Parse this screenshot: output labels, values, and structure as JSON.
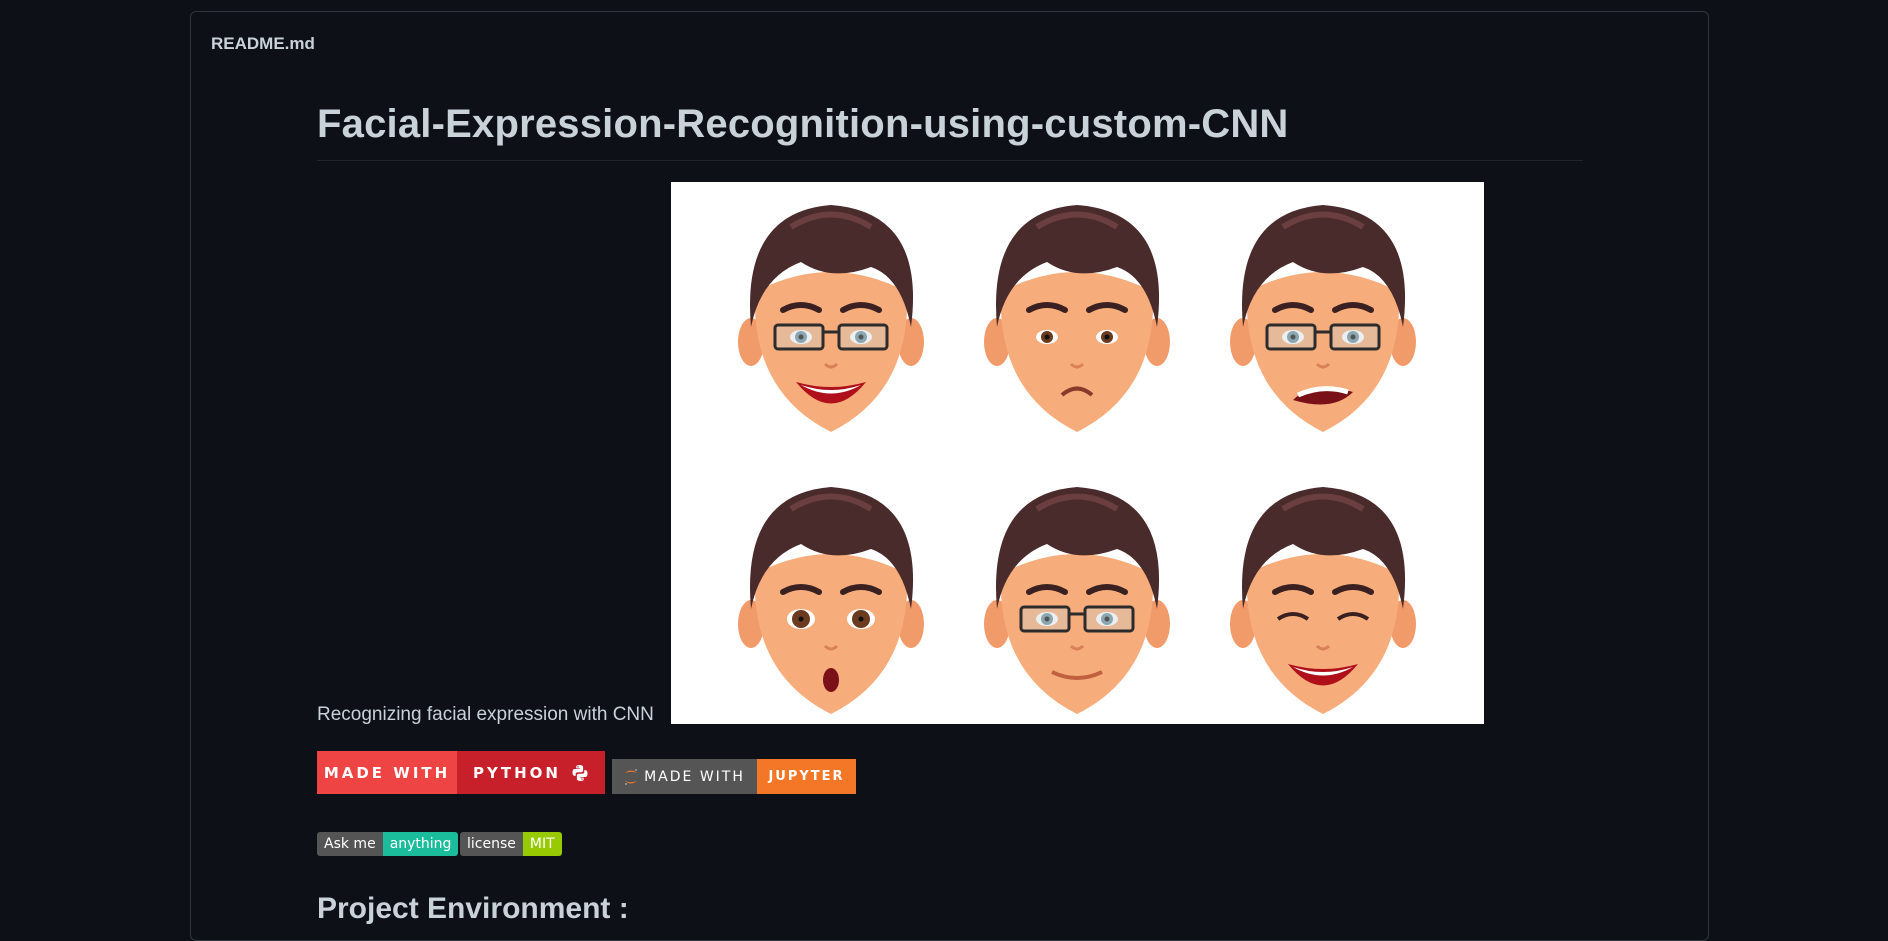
{
  "readme": {
    "filename": "README.md"
  },
  "title": "Facial-Expression-Recognition-using-custom-CNN",
  "hero": {
    "caption": "Recognizing facial expression with CNN",
    "faces": [
      "happy",
      "sad",
      "disgust",
      "surprise",
      "neutral",
      "laugh"
    ]
  },
  "badges": {
    "python": {
      "left": "MADE WITH",
      "right": "PYTHON",
      "left_color": "#ef4444",
      "right_color": "#c8202a",
      "icon": "python-icon"
    },
    "jupyter": {
      "left": "MADE WITH",
      "right": "JUPYTER",
      "left_color": "#555555",
      "right_color": "#f37726",
      "icon": "jupyter-icon"
    },
    "ask": {
      "left": "Ask me",
      "right": "anything",
      "left_color": "#555555",
      "right_color": "#1abc9c"
    },
    "license": {
      "left": "license",
      "right": "MIT",
      "left_color": "#555555",
      "right_color": "#97ca00"
    }
  },
  "section": {
    "heading": "Project Environment :"
  }
}
